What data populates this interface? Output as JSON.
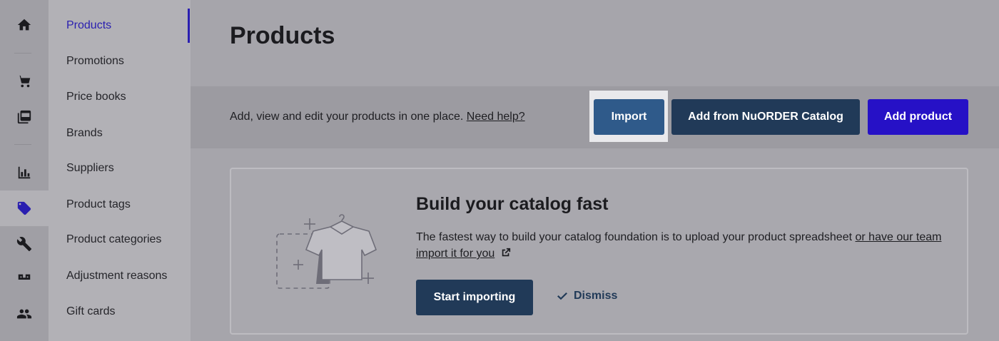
{
  "rail": {
    "items": [
      {
        "icon": "home-icon"
      },
      {
        "icon": "cart-icon"
      },
      {
        "icon": "catalog-icon"
      },
      {
        "icon": "analytics-icon"
      },
      {
        "icon": "tag-icon",
        "active": true
      },
      {
        "icon": "wrench-icon"
      },
      {
        "icon": "inventory-icon"
      },
      {
        "icon": "users-icon"
      }
    ]
  },
  "subnav": {
    "items": [
      {
        "label": "Products",
        "active": true
      },
      {
        "label": "Promotions"
      },
      {
        "label": "Price books"
      },
      {
        "label": "Brands"
      },
      {
        "label": "Suppliers"
      },
      {
        "label": "Product tags"
      },
      {
        "label": "Product categories"
      },
      {
        "label": "Adjustment reasons"
      },
      {
        "label": "Gift cards"
      }
    ]
  },
  "page": {
    "title": "Products"
  },
  "toolbar": {
    "description": "Add, view and edit your products in one place.",
    "help_link": "Need help?",
    "import_label": "Import",
    "catalog_label": "Add from NuORDER Catalog",
    "add_label": "Add product"
  },
  "card": {
    "title": "Build your catalog fast",
    "description": "The fastest way to build your catalog foundation is to upload your product spreadsheet",
    "link": "or have our team import it for you",
    "start_label": "Start importing",
    "dismiss_label": "Dismiss"
  },
  "colors": {
    "accent": "#2611c6",
    "navy": "#213a58",
    "import_blue": "#2f5a8a"
  }
}
